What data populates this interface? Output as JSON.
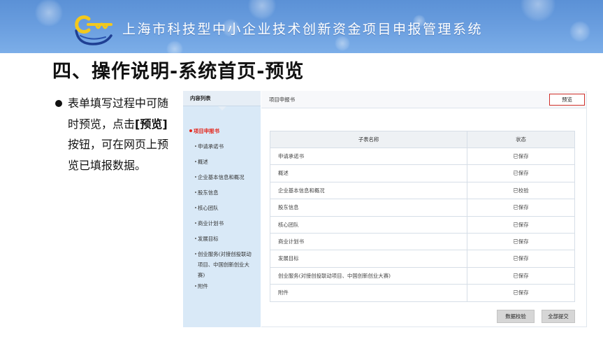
{
  "header": {
    "title": "上海市科技型中小企业技术创新资金项目申报管理系统",
    "logo_icon": "key-logo-icon"
  },
  "slide": {
    "heading": "四、操作说明-系统首页-预览",
    "bullet": {
      "icon": "bullet-dot-icon",
      "text_before": "表单填写过程中可随时预览，点击",
      "text_bold": "[预览]",
      "text_after": "按钮，可在网页上预览已填报数据。"
    }
  },
  "app": {
    "sidebar": {
      "title": "内容列表",
      "active_item": "项目申报书",
      "items": [
        "申请承诺书",
        "概述",
        "企业基本信息和概况",
        "股东信息",
        "核心团队",
        "商业计划书",
        "发展目标",
        "创业服务(对接创投联动项目、中国创新创业大赛)",
        "附件"
      ]
    },
    "main": {
      "breadcrumb": "项目申报书",
      "preview_button": "预览",
      "table": {
        "columns": [
          "子表名称",
          "状态"
        ],
        "rows": [
          {
            "name": "申请承诺书",
            "status": "已保存"
          },
          {
            "name": "概述",
            "status": "已保存"
          },
          {
            "name": "企业基本信息和概况",
            "status": "已校验"
          },
          {
            "name": "股东信息",
            "status": "已保存"
          },
          {
            "name": "核心团队",
            "status": "已保存"
          },
          {
            "name": "商业计划书",
            "status": "已保存"
          },
          {
            "name": "发展目标",
            "status": "已保存"
          },
          {
            "name": "创业服务(对接创投联动项目、中国创新创业大赛)",
            "status": "已保存"
          },
          {
            "name": "附件",
            "status": "已保存"
          }
        ]
      },
      "actions": {
        "validate": "数据校验",
        "submit_all": "全部提交"
      }
    }
  },
  "colors": {
    "header_band": "#5b91d6",
    "sidebar_bg": "#d9e9f7",
    "active_item": "#e3261c",
    "highlight_border": "#d0302a",
    "table_header_bg": "#eef1f4",
    "button_bg": "#d6d6d6"
  }
}
